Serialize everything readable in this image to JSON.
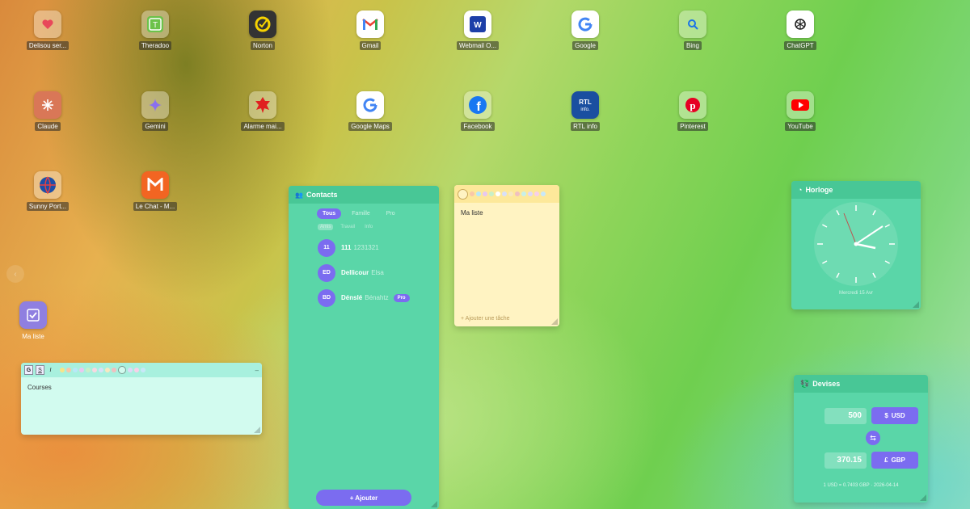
{
  "apps": [
    {
      "label": "Delisou ser...",
      "icon": "heart-icon",
      "color": "#e8485a"
    },
    {
      "label": "Theradoo",
      "icon": "theradoo-icon",
      "color": "#6cc24a"
    },
    {
      "label": "Norton",
      "icon": "norton-icon",
      "color": "#f6d200"
    },
    {
      "label": "Gmail",
      "icon": "gmail-icon",
      "color": "#ea4335"
    },
    {
      "label": "Webmail O...",
      "icon": "webmail-icon",
      "color": "#1d3fa8"
    },
    {
      "label": "Google",
      "icon": "google-icon",
      "color": "#4285f4"
    },
    {
      "label": "Bing",
      "icon": "search-icon",
      "color": "#1a73e8"
    },
    {
      "label": "ChatGPT",
      "icon": "chatgpt-icon",
      "color": "#222222"
    },
    {
      "label": "Claude",
      "icon": "claude-icon",
      "color": "#d97757"
    },
    {
      "label": "Gemini",
      "icon": "gemini-icon",
      "color": "#8a6ff0"
    },
    {
      "label": "Alarme mai...",
      "icon": "alarm-icon",
      "color": "#e02020"
    },
    {
      "label": "Google Maps",
      "icon": "google-icon",
      "color": "#4285f4"
    },
    {
      "label": "Facebook",
      "icon": "facebook-icon",
      "color": "#1877f2"
    },
    {
      "label": "RTL info",
      "icon": "rtl-icon",
      "color": "#1a4fa0"
    },
    {
      "label": "Pinterest",
      "icon": "pinterest-icon",
      "color": "#e60023"
    },
    {
      "label": "YouTube",
      "icon": "youtube-icon",
      "color": "#ff0000"
    },
    {
      "label": "Sunny Port...",
      "icon": "globe-icon",
      "color": "#1d4fa8"
    },
    {
      "label": "Le Chat - M...",
      "icon": "lechat-icon",
      "color": "#f26522"
    },
    {
      "label": "Ma liste",
      "icon": "checkbox-icon",
      "color": "#7b6cf0"
    }
  ],
  "contacts": {
    "title": "Contacts",
    "tabs": [
      "Tous",
      "Famille",
      "Pro"
    ],
    "subtabs": [
      "Amis",
      "Travail",
      "Info"
    ],
    "items": [
      {
        "initials": "11",
        "name": "111",
        "sub": "1231321",
        "badge": ""
      },
      {
        "initials": "ED",
        "name": "Dellicour",
        "sub": "Elsa",
        "badge": ""
      },
      {
        "initials": "BD",
        "name": "Dénslé",
        "sub": "Bénahtz",
        "badge": "Pro"
      }
    ],
    "add_label": "+ Ajouter"
  },
  "note_yellow": {
    "text": "Ma liste",
    "add_placeholder": "+ Ajouter une tâche"
  },
  "note_mint": {
    "bold": "G",
    "underline": "S",
    "italic": "I",
    "text": "Courses",
    "minimize": "–"
  },
  "clock": {
    "title": "Horloge",
    "date": "Mercredi 15 Avr"
  },
  "currency": {
    "title": "Devises",
    "from_amount": "500",
    "from_symbol": "$",
    "from_code": "USD",
    "to_amount": "370.15",
    "to_symbol": "£",
    "to_code": "GBP",
    "rate": "1 USD = 0.7403 GBP · 2026-04-14"
  },
  "colors": {
    "accent": "#7b6cf0",
    "widget": "#5ad6a8",
    "note_yellow": "#fff3c2",
    "note_mint": "#d2fbef"
  }
}
